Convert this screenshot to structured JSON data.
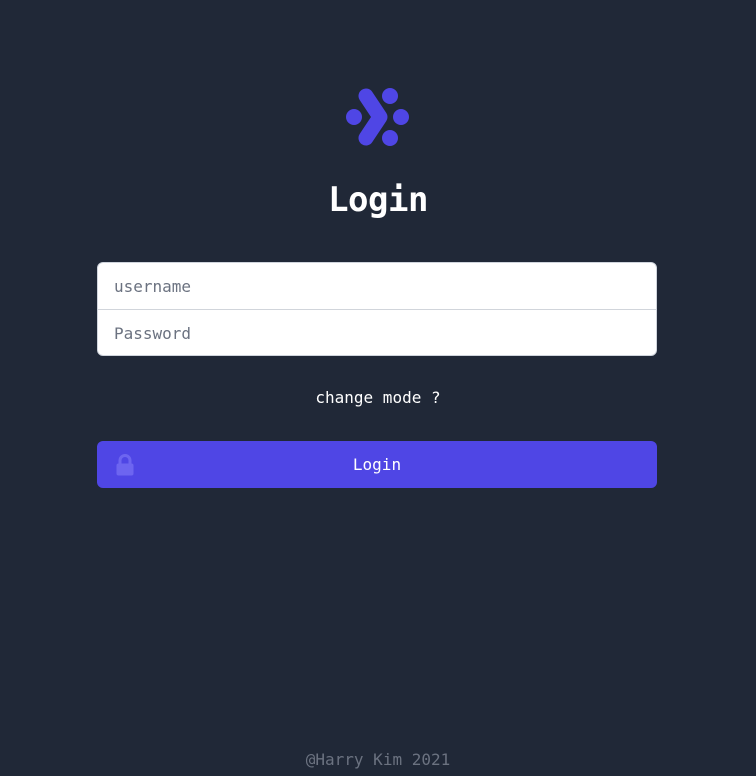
{
  "logo": {
    "icon": "brand-logo-icon",
    "color": "#4f46e5"
  },
  "page": {
    "title": "Login",
    "background": "#202837"
  },
  "form": {
    "username": {
      "value": "",
      "placeholder": "username"
    },
    "password": {
      "value": "",
      "placeholder": "Password"
    }
  },
  "change_mode_label": "change mode ?",
  "login_button": {
    "label": "Login",
    "icon": "lock-icon",
    "color": "#4f46e5"
  },
  "footer": {
    "text": "@Harry Kim 2021"
  }
}
